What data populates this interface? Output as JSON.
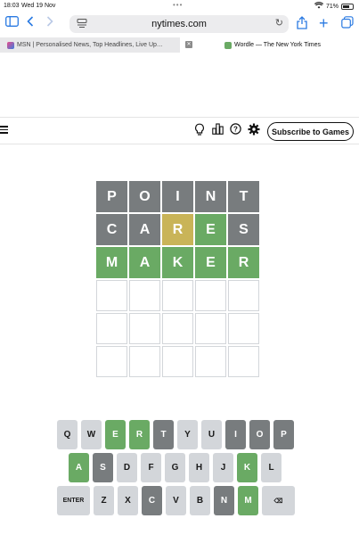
{
  "status_bar": {
    "time": "18:03",
    "date": "Wed 19 Nov",
    "battery": "71%",
    "battery_level": 0.71
  },
  "browser": {
    "url": "nytimes.com",
    "tabs": [
      {
        "title": "MSN | Personalised News, Top Headlines, Live Up…",
        "active": false
      },
      {
        "title": "Wordle — The New York Times",
        "active": true
      }
    ]
  },
  "game_header": {
    "subscribe_label": "Subscribe to Games"
  },
  "board": {
    "rows": [
      [
        {
          "letter": "P",
          "state": "absent"
        },
        {
          "letter": "O",
          "state": "absent"
        },
        {
          "letter": "I",
          "state": "absent"
        },
        {
          "letter": "N",
          "state": "absent"
        },
        {
          "letter": "T",
          "state": "absent"
        }
      ],
      [
        {
          "letter": "C",
          "state": "absent"
        },
        {
          "letter": "A",
          "state": "absent"
        },
        {
          "letter": "R",
          "state": "present"
        },
        {
          "letter": "E",
          "state": "correct"
        },
        {
          "letter": "S",
          "state": "absent"
        }
      ],
      [
        {
          "letter": "M",
          "state": "correct"
        },
        {
          "letter": "A",
          "state": "correct"
        },
        {
          "letter": "K",
          "state": "correct"
        },
        {
          "letter": "E",
          "state": "correct"
        },
        {
          "letter": "R",
          "state": "correct"
        }
      ],
      [
        {
          "letter": "",
          "state": "empty"
        },
        {
          "letter": "",
          "state": "empty"
        },
        {
          "letter": "",
          "state": "empty"
        },
        {
          "letter": "",
          "state": "empty"
        },
        {
          "letter": "",
          "state": "empty"
        }
      ],
      [
        {
          "letter": "",
          "state": "empty"
        },
        {
          "letter": "",
          "state": "empty"
        },
        {
          "letter": "",
          "state": "empty"
        },
        {
          "letter": "",
          "state": "empty"
        },
        {
          "letter": "",
          "state": "empty"
        }
      ],
      [
        {
          "letter": "",
          "state": "empty"
        },
        {
          "letter": "",
          "state": "empty"
        },
        {
          "letter": "",
          "state": "empty"
        },
        {
          "letter": "",
          "state": "empty"
        },
        {
          "letter": "",
          "state": "empty"
        }
      ]
    ]
  },
  "keyboard": {
    "rows": [
      [
        {
          "label": "Q",
          "state": "default"
        },
        {
          "label": "W",
          "state": "default"
        },
        {
          "label": "E",
          "state": "correct"
        },
        {
          "label": "R",
          "state": "correct"
        },
        {
          "label": "T",
          "state": "absent"
        },
        {
          "label": "Y",
          "state": "default"
        },
        {
          "label": "U",
          "state": "default"
        },
        {
          "label": "I",
          "state": "absent"
        },
        {
          "label": "O",
          "state": "absent"
        },
        {
          "label": "P",
          "state": "absent"
        }
      ],
      [
        {
          "label": "A",
          "state": "correct"
        },
        {
          "label": "S",
          "state": "absent"
        },
        {
          "label": "D",
          "state": "default"
        },
        {
          "label": "F",
          "state": "default"
        },
        {
          "label": "G",
          "state": "default"
        },
        {
          "label": "H",
          "state": "default"
        },
        {
          "label": "J",
          "state": "default"
        },
        {
          "label": "K",
          "state": "correct"
        },
        {
          "label": "L",
          "state": "default"
        }
      ],
      [
        {
          "label": "ENTER",
          "state": "default",
          "wide": true
        },
        {
          "label": "Z",
          "state": "default"
        },
        {
          "label": "X",
          "state": "default"
        },
        {
          "label": "C",
          "state": "absent"
        },
        {
          "label": "V",
          "state": "default"
        },
        {
          "label": "B",
          "state": "default"
        },
        {
          "label": "N",
          "state": "absent"
        },
        {
          "label": "M",
          "state": "correct"
        },
        {
          "label": "⌫",
          "state": "default",
          "wide": true
        }
      ]
    ]
  },
  "colors": {
    "correct": "#6aaa64",
    "present": "#c9b458",
    "absent": "#787c7e",
    "key_default": "#d3d6da",
    "empty_border": "#d3d6da",
    "browser_accent": "#2a7ae2"
  },
  "icons": {
    "hint": "lightbulb-icon",
    "stats": "bar-chart-icon",
    "help": "help-icon",
    "settings": "gear-icon"
  }
}
